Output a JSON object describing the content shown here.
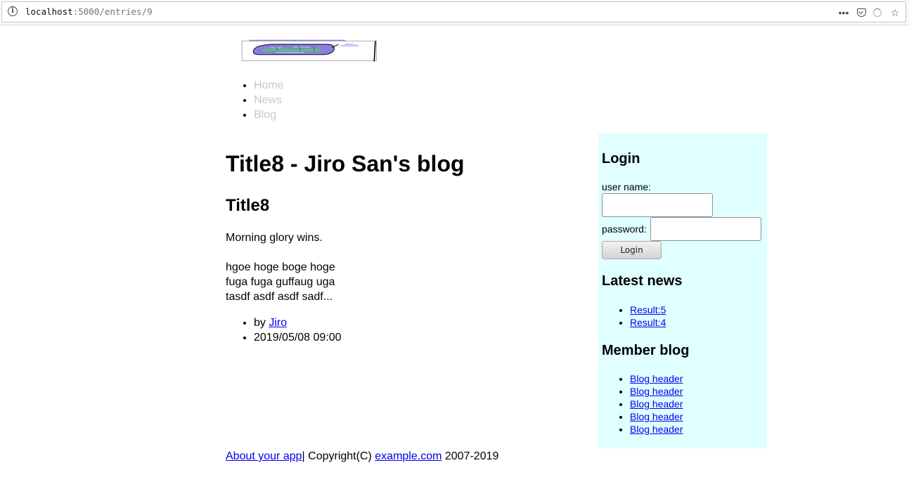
{
  "browser": {
    "url_host": "localhost",
    "url_path": ":5000/entries/9"
  },
  "nav": {
    "items": [
      {
        "label": "Home"
      },
      {
        "label": "News"
      },
      {
        "label": "Blog"
      }
    ]
  },
  "main": {
    "page_title": "Title8 - Jiro San's blog",
    "entry": {
      "title": "Title8",
      "summary": "Morning glory wins.",
      "body_lines": [
        "hgoe hoge boge hoge",
        "fuga fuga guffaug uga",
        "tasdf asdf asdf sadf..."
      ],
      "by_prefix": "by ",
      "author": "Jiro",
      "datetime": "2019/05/08 09:00"
    }
  },
  "sidebar": {
    "login": {
      "title": "Login",
      "username_label": "user name:",
      "username_value": "",
      "password_label": "password:",
      "password_value": "",
      "button_label": "Login"
    },
    "news": {
      "title": "Latest news",
      "items": [
        {
          "label": "Result:5"
        },
        {
          "label": "Result:4"
        }
      ]
    },
    "member_blog": {
      "title": "Member blog",
      "items": [
        {
          "label": "Blog header"
        },
        {
          "label": "Blog header"
        },
        {
          "label": "Blog header"
        },
        {
          "label": "Blog header"
        },
        {
          "label": "Blog header"
        }
      ]
    },
    "background_color": "#e0ffff"
  },
  "footer": {
    "about_link": "About your app",
    "separator_text": "| Copyright(C) ",
    "site_link": "example.com",
    "years": " 2007-2019"
  },
  "colors": {
    "link": "#0000ee",
    "nav_link": "#c8c8c8",
    "logo_fill": "#8a7fe0",
    "logo_accent": "#4cd44c"
  },
  "icons": {
    "site_info": "info-icon",
    "menu": "more-horizontal-icon",
    "pocket": "pocket-icon",
    "loading": "loading-icon",
    "bookmark": "star-icon"
  }
}
